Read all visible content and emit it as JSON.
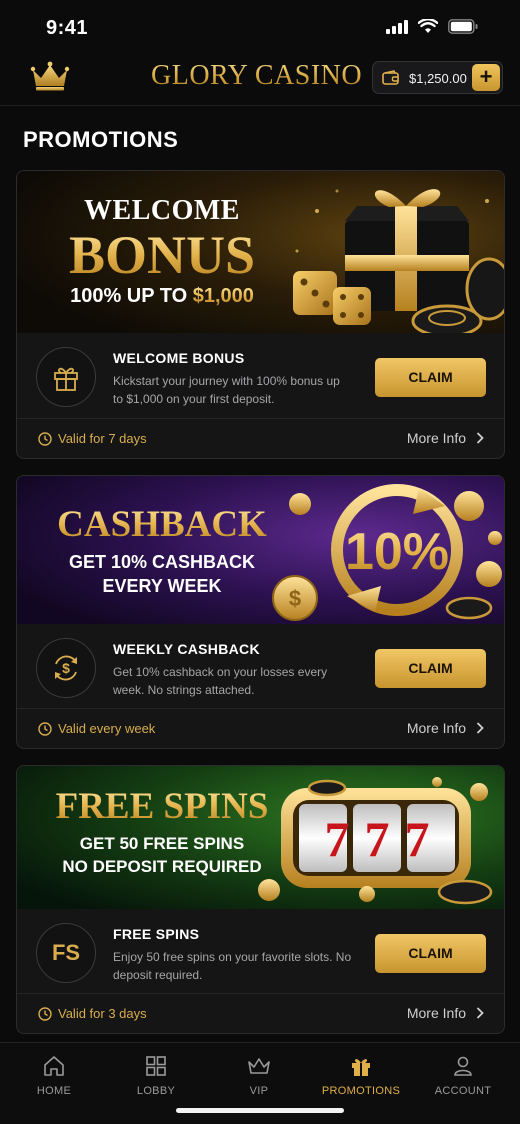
{
  "status_bar": {
    "time": "9:41"
  },
  "header": {
    "brand": "GLORY CASINO",
    "balance": "$1,250.00",
    "add_label": "+"
  },
  "page_title": "PROMOTIONS",
  "promotions": [
    {
      "banner": {
        "line1": "WELCOME",
        "line2": "BONUS",
        "line3_prefix": "100% UP TO ",
        "line3_amount": "$1,000"
      },
      "name": "WELCOME BONUS",
      "description": "Kickstart your journey with 100% bonus up to $1,000 on your first deposit.",
      "claim_label": "CLAIM",
      "validity": "Valid for 7 days",
      "more_info_label": "More Info",
      "icon": "gift-icon"
    },
    {
      "banner": {
        "line1": "CASHBACK",
        "line2": "GET 10% CASHBACK",
        "line3": "EVERY WEEK",
        "badge": "10%"
      },
      "name": "WEEKLY CASHBACK",
      "description": "Get 10% cashback on your losses every week. No strings attached.",
      "claim_label": "CLAIM",
      "validity": "Valid every week",
      "more_info_label": "More Info",
      "icon": "cashback-icon"
    },
    {
      "banner": {
        "line1": "FREE SPINS",
        "line2": "GET 50 FREE SPINS",
        "line3": "NO DEPOSIT REQUIRED",
        "reel": "777"
      },
      "name": "FREE SPINS",
      "description": "Enjoy 50 free spins on your favorite slots. No deposit required.",
      "claim_label": "CLAIM",
      "validity": "Valid for 3 days",
      "more_info_label": "More Info",
      "icon_text": "FS"
    }
  ],
  "nav": {
    "items": [
      {
        "label": "HOME",
        "icon": "home-icon"
      },
      {
        "label": "LOBBY",
        "icon": "grid-icon"
      },
      {
        "label": "VIP",
        "icon": "crown-icon"
      },
      {
        "label": "PROMOTIONS",
        "icon": "gift-icon",
        "active": true
      },
      {
        "label": "ACCOUNT",
        "icon": "user-icon"
      }
    ]
  },
  "colors": {
    "gold": "#d8ad4d",
    "background": "#0b0b0c",
    "card": "#151516"
  }
}
